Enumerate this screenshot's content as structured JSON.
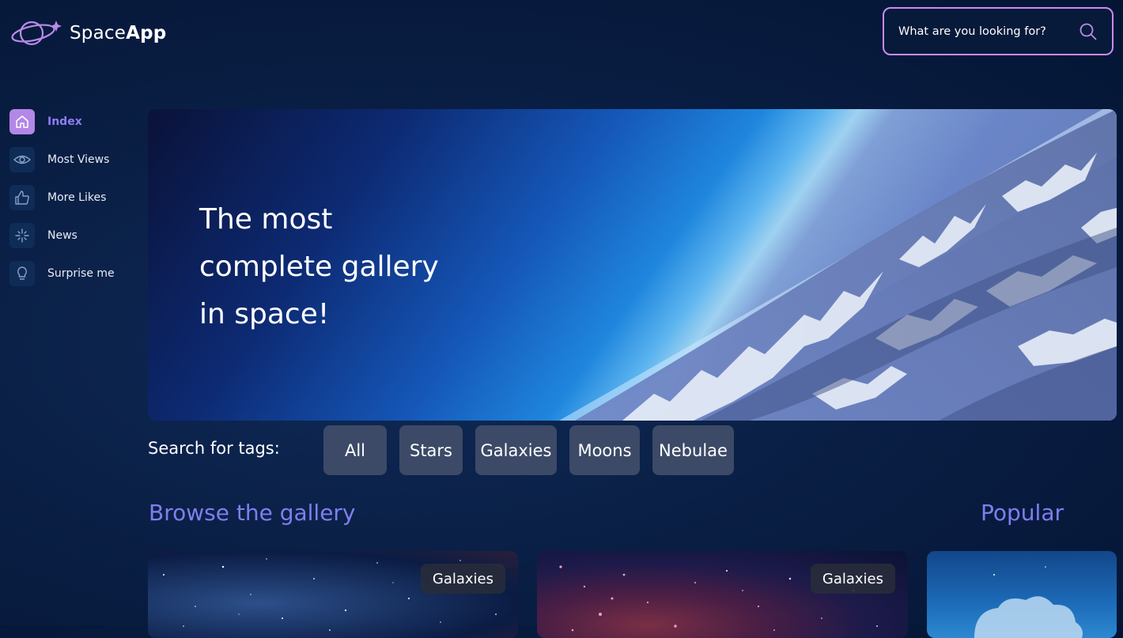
{
  "app": {
    "logo_text_light": "Space",
    "logo_text_bold": "App"
  },
  "search": {
    "placeholder": "What are you looking for?",
    "icon": "search-icon"
  },
  "sidebar": {
    "items": [
      {
        "label": "Index",
        "icon": "home-icon",
        "active": true
      },
      {
        "label": "Most Views",
        "icon": "eye-icon",
        "active": false
      },
      {
        "label": "More Likes",
        "icon": "thumbs-up-icon",
        "active": false
      },
      {
        "label": "News",
        "icon": "sparkle-icon",
        "active": false
      },
      {
        "label": "Surprise me",
        "icon": "lightbulb-icon",
        "active": false
      }
    ]
  },
  "hero": {
    "line1": "The most",
    "line2": "complete gallery",
    "line3": "in space!"
  },
  "tags": {
    "label": "Search for tags:",
    "items": [
      "All",
      "Stars",
      "Galaxies",
      "Moons",
      "Nebulae"
    ]
  },
  "sections": {
    "browse": "Browse the gallery",
    "popular": "Popular"
  },
  "gallery": {
    "cards": [
      {
        "tag": "Galaxies"
      },
      {
        "tag": "Galaxies"
      }
    ]
  },
  "colors": {
    "accent": "#8f7df4",
    "active_icon_bg": "#b387e6",
    "search_border": "#c98bf0",
    "tag_bg": "#3c4a67",
    "heading": "#7f7ef0"
  }
}
